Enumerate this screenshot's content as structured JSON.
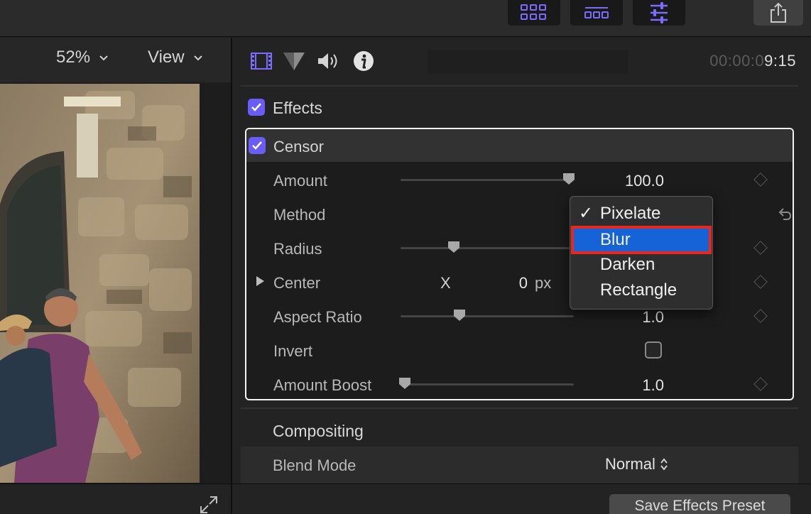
{
  "toolbar": {
    "browser_icon": "grid-icon",
    "timeline_icon": "timeline-icon",
    "inspector_icon": "sliders-icon",
    "share_icon": "share-icon",
    "accent_color": "#6a5cf6"
  },
  "viewer": {
    "zoom_label": "52%",
    "view_label": "View",
    "fullscreen_icon": "fullscreen-icon"
  },
  "inspector": {
    "tabs": [
      "video-icon",
      "color-icon",
      "audio-icon",
      "info-icon"
    ],
    "timecode_dim": "00:00:0",
    "timecode_lit": "9:15",
    "effects_section": "Effects",
    "effect": {
      "name": "Censor",
      "params": {
        "amount_label": "Amount",
        "amount_value": "100.0",
        "method_label": "Method",
        "radius_label": "Radius",
        "center_label": "Center",
        "center_axis": "X",
        "center_x": "0",
        "center_unit": "px",
        "aspect_label": "Aspect Ratio",
        "aspect_value": "1.0",
        "invert_label": "Invert",
        "boost_label": "Amount Boost",
        "boost_value": "1.0"
      },
      "method_menu": {
        "options": [
          "Pixelate",
          "Blur",
          "Darken",
          "Rectangle"
        ],
        "checked": "Pixelate",
        "highlighted": "Blur",
        "check_glyph": "✓"
      }
    },
    "compositing_section": "Compositing",
    "blend_mode_label": "Blend Mode",
    "blend_mode_value": "Normal",
    "save_preset_label": "Save Effects Preset"
  }
}
